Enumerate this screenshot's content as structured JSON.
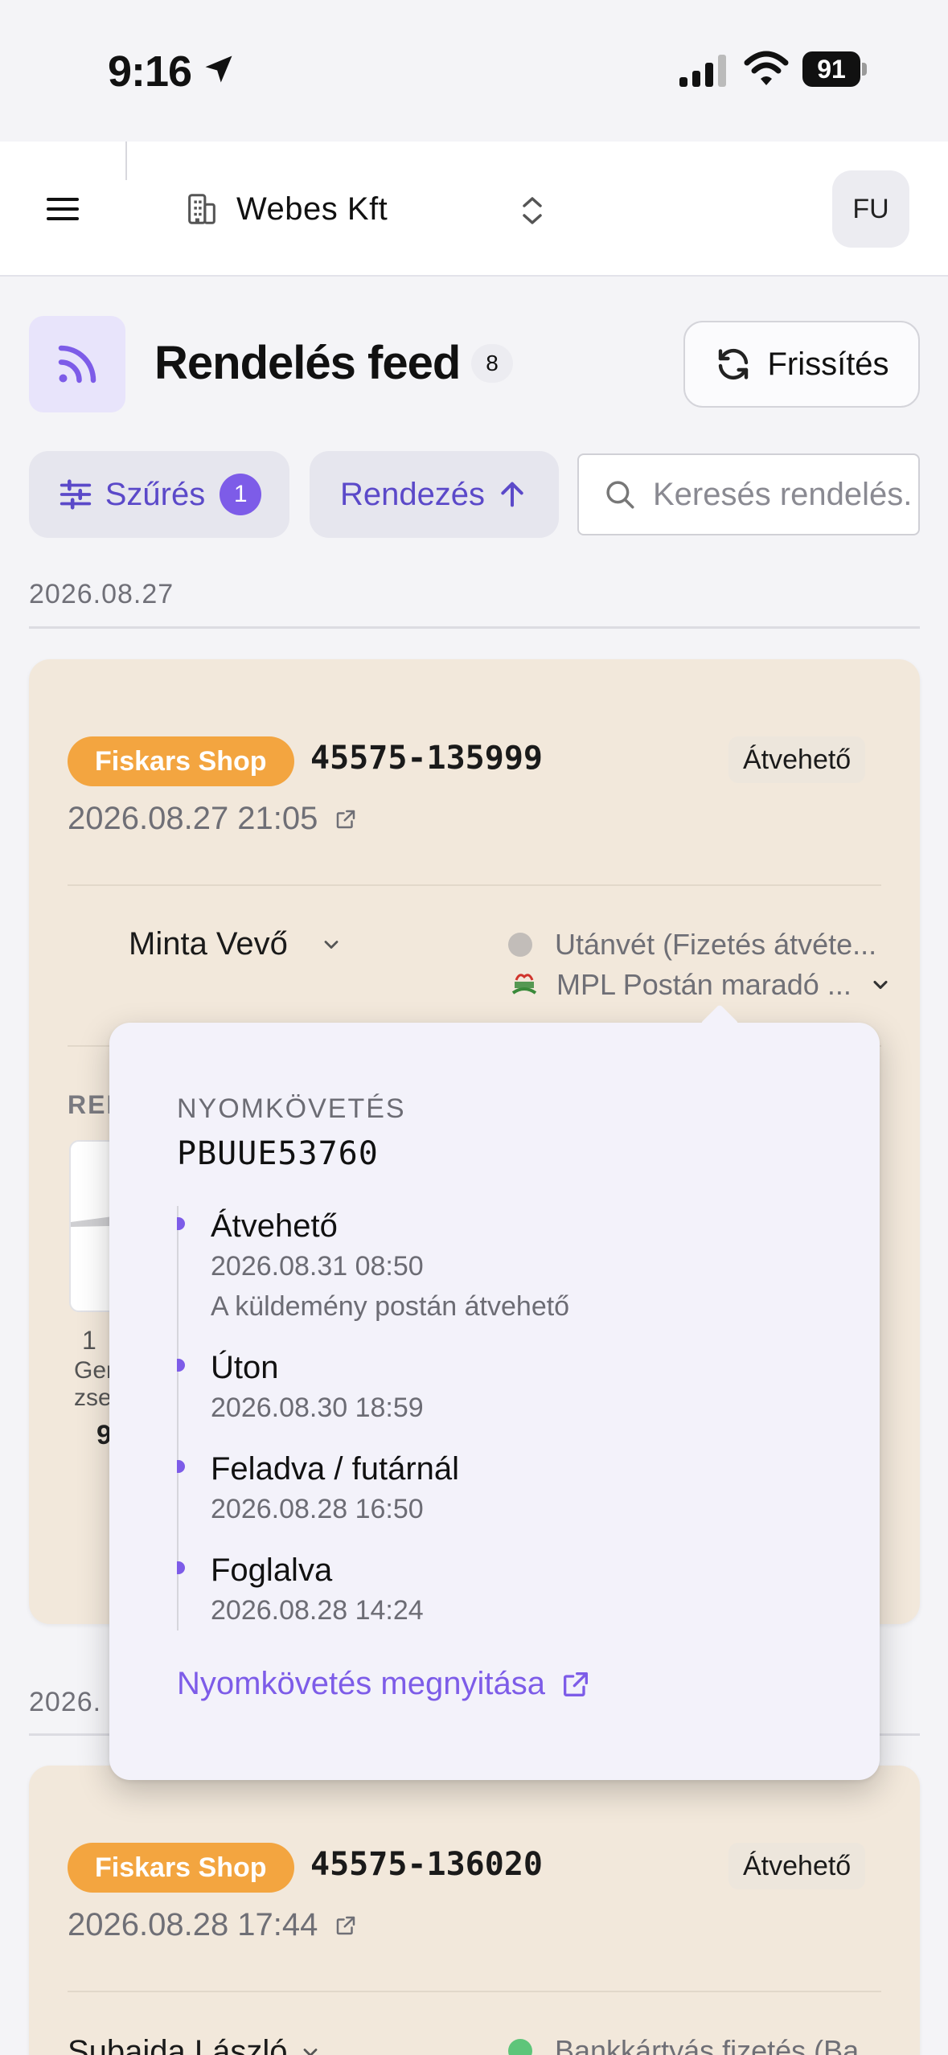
{
  "status_bar": {
    "time": "9:16",
    "battery": "91"
  },
  "header": {
    "org_name": "Webes  Kft",
    "avatar_initials": "FU"
  },
  "page": {
    "title": "Rendelés feed",
    "order_count": "8",
    "refresh_label": "Frissítés",
    "filter_label": "Szűrés",
    "filter_count": "1",
    "sort_label": "Rendezés",
    "search_placeholder": "Keresés rendelés..."
  },
  "groups": [
    {
      "date": "2026.08.27",
      "order": {
        "shop": "Fiskars Shop",
        "order_id": "45575-135999",
        "status": "Átvehető",
        "datetime": "2026.08.27 21:05",
        "customer": "Minta Vevő",
        "payment": "Utánvét (Fizetés átvéte...",
        "shipping": "MPL Postán maradó ...",
        "items_heading": "REN",
        "item_qty": "1",
        "item_name_1": "Ger",
        "item_name_2": "zse",
        "item_price": "9"
      }
    },
    {
      "date": "2026.",
      "order": {
        "shop": "Fiskars Shop",
        "order_id": "45575-136020",
        "status": "Átvehető",
        "datetime": "2026.08.28 17:44",
        "customer": "Subaida László",
        "payment": "Bankkártyás fizetés (Ba"
      }
    }
  ],
  "tracking": {
    "heading": "NYOMKÖVETÉS",
    "number": "PBUUE53760",
    "events": [
      {
        "status": "Átvehető",
        "date": "2026.08.31 08:50",
        "note": "A küldemény postán átvehető"
      },
      {
        "status": "Úton",
        "date": "2026.08.30 18:59"
      },
      {
        "status": "Feladva / futárnál",
        "date": "2026.08.28 16:50"
      },
      {
        "status": "Foglalva",
        "date": "2026.08.28 14:24"
      }
    ],
    "open_link": "Nyomkövetés megnyitása"
  },
  "colors": {
    "accent": "#7d5ce8",
    "shop_badge": "#f3a540",
    "card_bg": "#f2e8db",
    "payment_cod_dot": "#c2bdb9",
    "payment_card_dot": "#5ec57a"
  }
}
